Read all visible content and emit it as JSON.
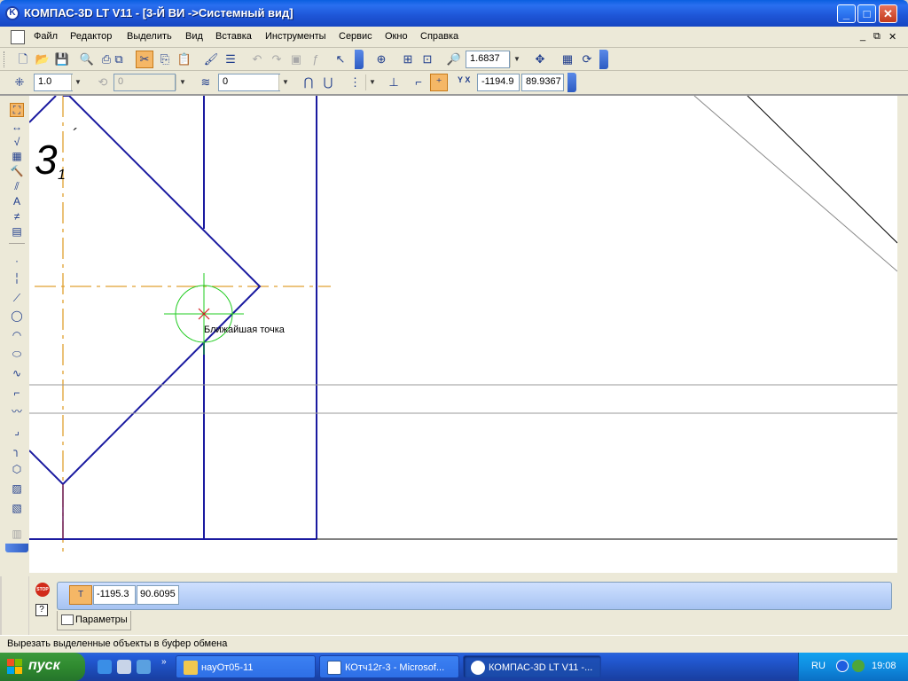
{
  "window": {
    "title": "КОМПАС-3D LT V11 - [3-Й ВИ ->Системный вид]",
    "app_icon": "K"
  },
  "menu": {
    "items": [
      "Файл",
      "Редактор",
      "Выделить",
      "Вид",
      "Вставка",
      "Инструменты",
      "Сервис",
      "Окно",
      "Справка"
    ]
  },
  "toolbar_standard": {
    "zoom_value": "1.6837"
  },
  "toolbar_current": {
    "step_value": "1.0",
    "angle_value": "0",
    "layer_value": "0",
    "coord_label": "Y X",
    "coord_x": "-1194.9",
    "coord_y": "89.9367"
  },
  "canvas": {
    "snap_tooltip": "Ближайшая точка",
    "view_label": "3",
    "view_sub": "1",
    "colors": {
      "geometry": "#1a1aa0",
      "axis": "#e0a030",
      "snap": "#22cc22",
      "cross": "#d02020"
    }
  },
  "property_bar": {
    "stop_label": "STOP",
    "help_label": "?",
    "point_icon_label": "T",
    "field_x": "-1195.3",
    "field_y": "90.6095",
    "tab_label": "Параметры"
  },
  "status": {
    "text": "Вырезать выделенные объекты в буфер обмена"
  },
  "taskbar": {
    "start_label": "пуск",
    "tasks": [
      {
        "label": "науОт05-11",
        "icon": "folder-icon"
      },
      {
        "label": "КОтч12г-3 - Microsof...",
        "icon": "word-icon"
      },
      {
        "label": "КОМПАС-3D LT V11 -...",
        "icon": "kompas-icon"
      }
    ],
    "chevron": "»",
    "lang": "RU",
    "clock": "19:08"
  }
}
